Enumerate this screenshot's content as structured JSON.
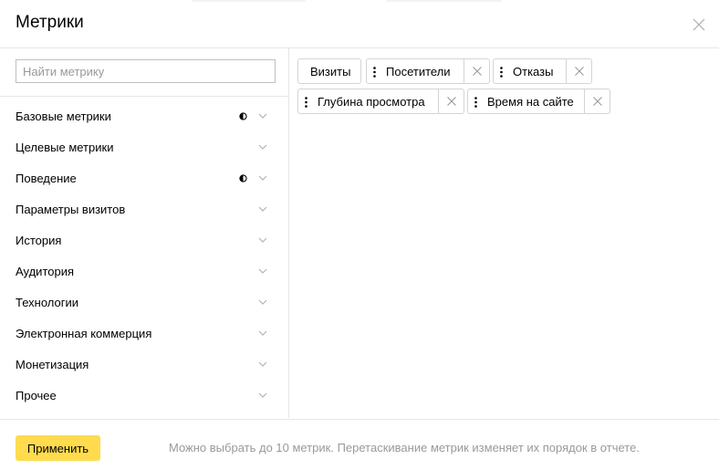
{
  "dialog": {
    "title": "Метрики"
  },
  "search": {
    "placeholder": "Найти метрику",
    "value": ""
  },
  "categories": [
    {
      "label": "Базовые метрики",
      "partial": true
    },
    {
      "label": "Целевые метрики",
      "partial": false
    },
    {
      "label": "Поведение",
      "partial": true
    },
    {
      "label": "Параметры визитов",
      "partial": false
    },
    {
      "label": "История",
      "partial": false
    },
    {
      "label": "Аудитория",
      "partial": false
    },
    {
      "label": "Технологии",
      "partial": false
    },
    {
      "label": "Электронная коммерция",
      "partial": false
    },
    {
      "label": "Монетизация",
      "partial": false
    },
    {
      "label": "Прочее",
      "partial": false
    }
  ],
  "selected_metrics": [
    {
      "label": "Визиты",
      "removable": false
    },
    {
      "label": "Посетители",
      "removable": true
    },
    {
      "label": "Отказы",
      "removable": true
    },
    {
      "label": "Глубина просмотра",
      "removable": true
    },
    {
      "label": "Время на сайте",
      "removable": true
    }
  ],
  "footer": {
    "apply_label": "Применить",
    "hint": "Можно выбрать до 10 метрик. Перетаскивание метрик изменяет их порядок в отчете."
  },
  "colors": {
    "accent": "#ffdb4d",
    "border": "#e6e6e6",
    "muted_text": "#999999"
  },
  "icons": {
    "close": "close-icon",
    "chevron": "chevron-down-icon",
    "partial": "half-circle-icon",
    "drag": "drag-handle-icon",
    "remove": "remove-icon"
  }
}
